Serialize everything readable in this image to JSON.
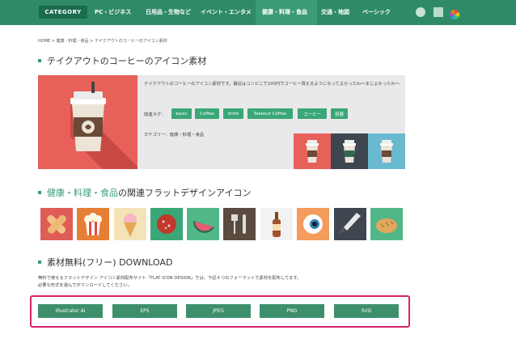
{
  "nav": {
    "category_label": "CATEGORY",
    "items": [
      "PC・ビジネス",
      "日用品・生物など",
      "イベント・エンタメ",
      "健康・料理・食品",
      "交通・地図",
      "ベーシック"
    ]
  },
  "breadcrumb": "HOME > 健康・料理・食品 > テイクアウトのコーヒーのアイコン素材",
  "page_title": "テイクアウトのコーヒーのアイコン素材",
  "hero": {
    "description": "テイクアウトのコーヒーのアイコン素材です。最近はコンビニで100円でコーヒー買えるようになってよかったわ〜まじよかったわ〜",
    "tags_label": "関連タグ：",
    "tags": [
      "basic",
      "Coffee",
      "drink",
      "Takeout Coffee",
      "コーヒー",
      "容器"
    ],
    "category": "カテゴリー：健康・料理・食品"
  },
  "related": {
    "title_link": "健康・料理・食品",
    "title_rest": "の関連フラットデザインアイコン",
    "icons": [
      "bandage-icon",
      "popcorn-icon",
      "ice-cream-icon",
      "salami-icon",
      "watermelon-icon",
      "cutlery-icon",
      "beer-bottle-icon",
      "eyeball-icon",
      "knife-icon",
      "bread-icon"
    ]
  },
  "download": {
    "title": "素材無料(フリー) DOWNLOAD",
    "text_line1": "無料で使えるフラットデザイン アイコン素材配布サイト「FLAT ICON DESIGN」では、下記４つのフォーマットで素材を配布してます。",
    "text_line2": "必要な形式を選んでダウンロードしてください。",
    "buttons": [
      "Illustrator Ai",
      "EPS",
      "JPEG",
      "PNG",
      "SVG"
    ]
  },
  "colors": {
    "brand": "#2f8a68",
    "accent": "#3aa776",
    "highlight": "#d8236c"
  }
}
